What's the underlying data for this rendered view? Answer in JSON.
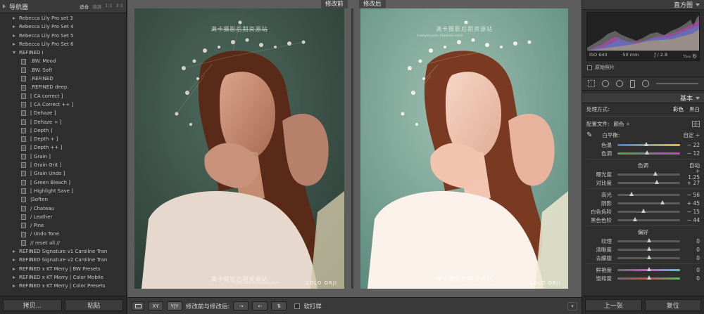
{
  "navigator": {
    "title": "导航器",
    "zoom": [
      "适合",
      "填满",
      "1:1",
      "3:1"
    ]
  },
  "presets": [
    {
      "label": "Rebecca Lily Pro set 3",
      "kind": "folder"
    },
    {
      "label": "Rebecca Lily Pro Set 4",
      "kind": "folder"
    },
    {
      "label": "Rebecca Lily Pro Set 5",
      "kind": "folder"
    },
    {
      "label": "Rebecca Lily Pro Set 6",
      "kind": "folder"
    },
    {
      "label": "REFINED I",
      "kind": "open"
    },
    {
      "label": ".BW. Mood",
      "kind": "child"
    },
    {
      "label": ".BW. Soft",
      "kind": "child"
    },
    {
      "label": ".REFINED",
      "kind": "child"
    },
    {
      "label": ".REFINED deep.",
      "kind": "child"
    },
    {
      "label": "[ CA correct ]",
      "kind": "child"
    },
    {
      "label": "[ CA Correct ++ ]",
      "kind": "child"
    },
    {
      "label": "[ Dehaze ]",
      "kind": "child"
    },
    {
      "label": "[ Dehaze + ]",
      "kind": "child"
    },
    {
      "label": "[ Depth ]",
      "kind": "child"
    },
    {
      "label": "[ Depth + ]",
      "kind": "child"
    },
    {
      "label": "[ Depth ++ ]",
      "kind": "child"
    },
    {
      "label": "[ Grain ]",
      "kind": "child"
    },
    {
      "label": "[ Grain Grit ]",
      "kind": "child"
    },
    {
      "label": "[ Grain Undo ]",
      "kind": "child"
    },
    {
      "label": "[ Green Bleach ]",
      "kind": "child"
    },
    {
      "label": "[ Highlight Save ]",
      "kind": "child"
    },
    {
      "label": "|Soften",
      "kind": "child"
    },
    {
      "label": "/ Chateau",
      "kind": "child"
    },
    {
      "label": "/ Leather",
      "kind": "child"
    },
    {
      "label": "/ Pine",
      "kind": "child"
    },
    {
      "label": "/ Undo Tone",
      "kind": "child"
    },
    {
      "label": "// reset all //",
      "kind": "child"
    },
    {
      "label": "REFINED Signature v1 Caroline Tran",
      "kind": "folder"
    },
    {
      "label": "REFINED Signature v2 Caroline Tran",
      "kind": "folder"
    },
    {
      "label": "REFINED x KT Merry | BW Presets",
      "kind": "folder"
    },
    {
      "label": "REFINED x KT Merry | Color Mobile",
      "kind": "folder"
    },
    {
      "label": "REFINED x KT Merry | Color Presets",
      "kind": "folder"
    }
  ],
  "left_buttons": {
    "copy": "拷贝...",
    "paste": "粘贴"
  },
  "view": {
    "before_label": "修改前",
    "after_label": "修改后",
    "watermark": "满卡摄影后期资源站",
    "watermark_sub": "Izaoyouyou.taobao.com",
    "brand": "LOLO ORJI"
  },
  "toolbar": {
    "before_after_label": "修改前与修改后:",
    "softproof_label": "软打样"
  },
  "histogram": {
    "title": "直方图",
    "iso": "ISO 640",
    "focal": "50 mm",
    "aperture": "ƒ / 2.8",
    "shutter": "¹⁄₁₀₀ 秒",
    "original_label": "原始照片"
  },
  "basic": {
    "title": "基本",
    "treatment_label": "处理方式:",
    "treatment_color": "彩色",
    "treatment_bw": "黑白",
    "profile_label": "配置文件:",
    "profile_value": "颜色 ÷",
    "wb_label": "白平衡:",
    "wb_value": "自定 ÷",
    "tone_title": "色调",
    "tone_auto": "自动",
    "presence_title": "偏好",
    "sliders_wb": [
      {
        "label": "色温",
        "value": "− 22",
        "pos": 0.46
      },
      {
        "label": "色调",
        "value": "− 12",
        "pos": 0.47
      }
    ],
    "sliders_tone1": [
      {
        "label": "曝光度",
        "value": "+ 1.25",
        "pos": 0.61
      },
      {
        "label": "对比度",
        "value": "+ 27",
        "pos": 0.63
      }
    ],
    "sliders_tone2": [
      {
        "label": "高光",
        "value": "− 56",
        "pos": 0.22
      },
      {
        "label": "阴影",
        "value": "+ 45",
        "pos": 0.72
      },
      {
        "label": "白色色阶",
        "value": "− 15",
        "pos": 0.42
      },
      {
        "label": "黑色色阶",
        "value": "− 44",
        "pos": 0.28
      }
    ],
    "sliders_presence1": [
      {
        "label": "纹理",
        "value": "0",
        "pos": 0.5
      },
      {
        "label": "清晰度",
        "value": "0",
        "pos": 0.5
      },
      {
        "label": "去朦胧",
        "value": "0",
        "pos": 0.5
      }
    ],
    "sliders_presence2": [
      {
        "label": "鲜艳度",
        "value": "0",
        "pos": 0.5
      },
      {
        "label": "饱和度",
        "value": "0",
        "pos": 0.5
      }
    ]
  },
  "right_buttons": {
    "prev": "上一张",
    "reset": "复位"
  }
}
